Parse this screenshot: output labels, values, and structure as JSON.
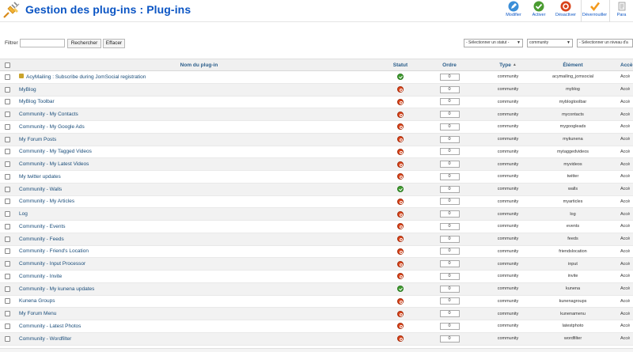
{
  "header": {
    "title": "Gestion des plug-ins : Plug-ins",
    "logo_icon": "plugin-plug-icon"
  },
  "toolbar": [
    {
      "name": "modifier",
      "label": "Modifier",
      "icon": "pencil-icon",
      "color": "#3a8ed8"
    },
    {
      "name": "activer",
      "label": "Activer",
      "icon": "check-icon",
      "color": "#4a9b30"
    },
    {
      "name": "desactiver",
      "label": "Désactiver",
      "icon": "disable-icon",
      "color": "#d9431a"
    },
    {
      "name": "deverrouiller",
      "label": "Déverrouiller",
      "icon": "unlock-check-icon",
      "color": "#f39a1d"
    },
    {
      "name": "parametres",
      "label": "Para",
      "icon": "settings-icon",
      "color": "#999999"
    }
  ],
  "filter": {
    "label": "Filtrer",
    "value": "",
    "search_button": "Rechercher",
    "clear_button": "Effacer",
    "status_select": "- Sélectionner un statut -",
    "type_select": "community",
    "access_select": "- Sélectionner un niveau d'a"
  },
  "table": {
    "headers": {
      "name": "Nom du plug-in",
      "status": "Statut",
      "order": "Ordre",
      "type": "Type",
      "element": "Élément",
      "access": "Accè"
    },
    "rows": [
      {
        "name": "AcyMailing : Subscribe during JomSocial registration",
        "locked": true,
        "status": "on",
        "order": "0",
        "type": "community",
        "element": "acymailing_jomsocial",
        "access": "Accè"
      },
      {
        "name": "MyBlog",
        "locked": false,
        "status": "off",
        "order": "0",
        "type": "community",
        "element": "myblog",
        "access": "Accè"
      },
      {
        "name": "MyBlog Toolbar",
        "locked": false,
        "status": "off",
        "order": "0",
        "type": "community",
        "element": "myblogtoolbar",
        "access": "Accè"
      },
      {
        "name": "Community - My Contacts",
        "locked": false,
        "status": "off",
        "order": "0",
        "type": "community",
        "element": "mycontacts",
        "access": "Accè"
      },
      {
        "name": "Community - My Google Ads",
        "locked": false,
        "status": "off",
        "order": "0",
        "type": "community",
        "element": "mygoogleads",
        "access": "Accè"
      },
      {
        "name": "My Forum Posts",
        "locked": false,
        "status": "off",
        "order": "0",
        "type": "community",
        "element": "mykunena",
        "access": "Accè"
      },
      {
        "name": "Community - My Tagged Videos",
        "locked": false,
        "status": "off",
        "order": "0",
        "type": "community",
        "element": "mytaggedvideos",
        "access": "Accè"
      },
      {
        "name": "Community - My Latest Videos",
        "locked": false,
        "status": "off",
        "order": "0",
        "type": "community",
        "element": "myvideos",
        "access": "Accè"
      },
      {
        "name": "My twitter updates",
        "locked": false,
        "status": "off",
        "order": "0",
        "type": "community",
        "element": "twitter",
        "access": "Accè"
      },
      {
        "name": "Community - Walls",
        "locked": false,
        "status": "on",
        "order": "0",
        "type": "community",
        "element": "walls",
        "access": "Accè"
      },
      {
        "name": "Community - My Articles",
        "locked": false,
        "status": "off",
        "order": "0",
        "type": "community",
        "element": "myarticles",
        "access": "Accè"
      },
      {
        "name": "Log",
        "locked": false,
        "status": "off",
        "order": "0",
        "type": "community",
        "element": "log",
        "access": "Accè"
      },
      {
        "name": "Community - Events",
        "locked": false,
        "status": "off",
        "order": "0",
        "type": "community",
        "element": "events",
        "access": "Accè"
      },
      {
        "name": "Community - Feeds",
        "locked": false,
        "status": "off",
        "order": "0",
        "type": "community",
        "element": "feeds",
        "access": "Accè"
      },
      {
        "name": "Community - Friend's Location",
        "locked": false,
        "status": "off",
        "order": "0",
        "type": "community",
        "element": "friendslocation",
        "access": "Accè"
      },
      {
        "name": "Community - Input Processor",
        "locked": false,
        "status": "off",
        "order": "0",
        "type": "community",
        "element": "input",
        "access": "Accè"
      },
      {
        "name": "Community - Invite",
        "locked": false,
        "status": "off",
        "order": "0",
        "type": "community",
        "element": "invite",
        "access": "Accè"
      },
      {
        "name": "Community - My kunena updates",
        "locked": false,
        "status": "on",
        "order": "0",
        "type": "community",
        "element": "kunena",
        "access": "Accè"
      },
      {
        "name": "Kunena Groups",
        "locked": false,
        "status": "off",
        "order": "0",
        "type": "community",
        "element": "kunenagroups",
        "access": "Accè"
      },
      {
        "name": "My Forum Menu",
        "locked": false,
        "status": "off",
        "order": "0",
        "type": "community",
        "element": "kunenamenu",
        "access": "Accè"
      },
      {
        "name": "Community - Latest Photos",
        "locked": false,
        "status": "off",
        "order": "0",
        "type": "community",
        "element": "latestphoto",
        "access": "Accè"
      },
      {
        "name": "Community - Wordfilter",
        "locked": false,
        "status": "off",
        "order": "0",
        "type": "community",
        "element": "wordfilter",
        "access": "Accè"
      }
    ]
  }
}
